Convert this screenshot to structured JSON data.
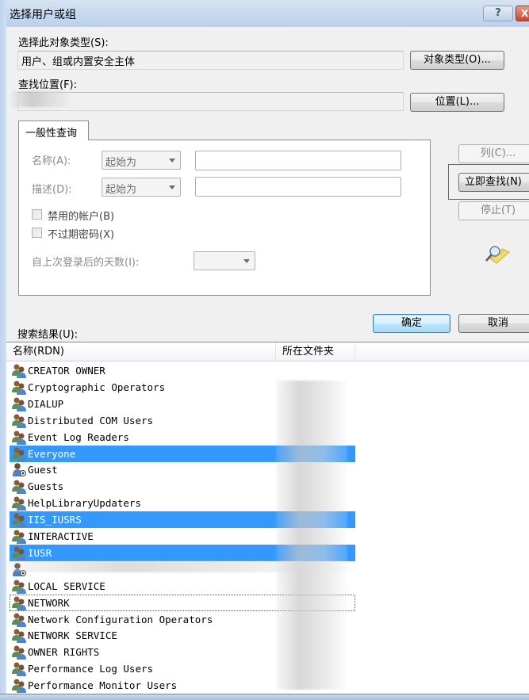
{
  "window": {
    "title": "选择用户或组",
    "help_label": "?",
    "close_label": "X"
  },
  "object_type": {
    "label": "选择此对象类型(S):",
    "value": "用户、组或内置安全主体",
    "button": "对象类型(O)..."
  },
  "location": {
    "label": "查找位置(F):",
    "value": "",
    "button": "位置(L)..."
  },
  "query_tab": {
    "tab_label": "一般性查询",
    "name_label": "名称(A):",
    "name_mode": "起始为",
    "name_value": "",
    "desc_label": "描述(D):",
    "desc_mode": "起始为",
    "desc_value": "",
    "disabled_accounts_label": "禁用的帐户(B)",
    "disabled_accounts_checked": false,
    "non_expiring_pwd_label": "不过期密码(X)",
    "non_expiring_pwd_checked": false,
    "days_since_logon_label": "自上次登录后的天数(I):",
    "days_since_logon_value": ""
  },
  "side_buttons": {
    "columns": "列(C)...",
    "find_now": "立即查找(N)",
    "stop": "停止(T)"
  },
  "dialog_buttons": {
    "ok": "确定",
    "cancel": "取消"
  },
  "results": {
    "label": "搜索结果(U):",
    "columns": [
      "名称(RDN)",
      "所在文件夹"
    ],
    "rows": [
      {
        "name": "CREATOR OWNER",
        "icon": "group-icon",
        "selected": false
      },
      {
        "name": "Cryptographic Operators",
        "icon": "group-icon",
        "selected": false
      },
      {
        "name": "DIALUP",
        "icon": "group-icon",
        "selected": false
      },
      {
        "name": "Distributed COM Users",
        "icon": "group-icon",
        "selected": false
      },
      {
        "name": "Event Log Readers",
        "icon": "group-icon",
        "selected": false
      },
      {
        "name": "Everyone",
        "icon": "group-icon",
        "selected": true
      },
      {
        "name": "Guest",
        "icon": "user-icon",
        "selected": false
      },
      {
        "name": "Guests",
        "icon": "group-icon",
        "selected": false
      },
      {
        "name": "HelpLibraryUpdaters",
        "icon": "group-icon",
        "selected": false
      },
      {
        "name": "IIS_IUSRS",
        "icon": "group-icon",
        "selected": true
      },
      {
        "name": "INTERACTIVE",
        "icon": "group-icon",
        "selected": false
      },
      {
        "name": "IUSR",
        "icon": "group-icon",
        "selected": true
      },
      {
        "name": "",
        "icon": "user-icon",
        "selected": false
      },
      {
        "name": "LOCAL SERVICE",
        "icon": "group-icon",
        "selected": false
      },
      {
        "name": "NETWORK",
        "icon": "group-icon",
        "selected": false,
        "focused": true
      },
      {
        "name": "Network Configuration Operators",
        "icon": "group-icon",
        "selected": false
      },
      {
        "name": "NETWORK SERVICE",
        "icon": "group-icon",
        "selected": false
      },
      {
        "name": "OWNER RIGHTS",
        "icon": "group-icon",
        "selected": false
      },
      {
        "name": "Performance Log Users",
        "icon": "group-icon",
        "selected": false
      },
      {
        "name": "Performance Monitor Users",
        "icon": "group-icon",
        "selected": false
      }
    ]
  },
  "colors": {
    "selection": "#3399ff",
    "highlight_box": "#e0383e",
    "default_button_border": "#3c7fb1"
  }
}
